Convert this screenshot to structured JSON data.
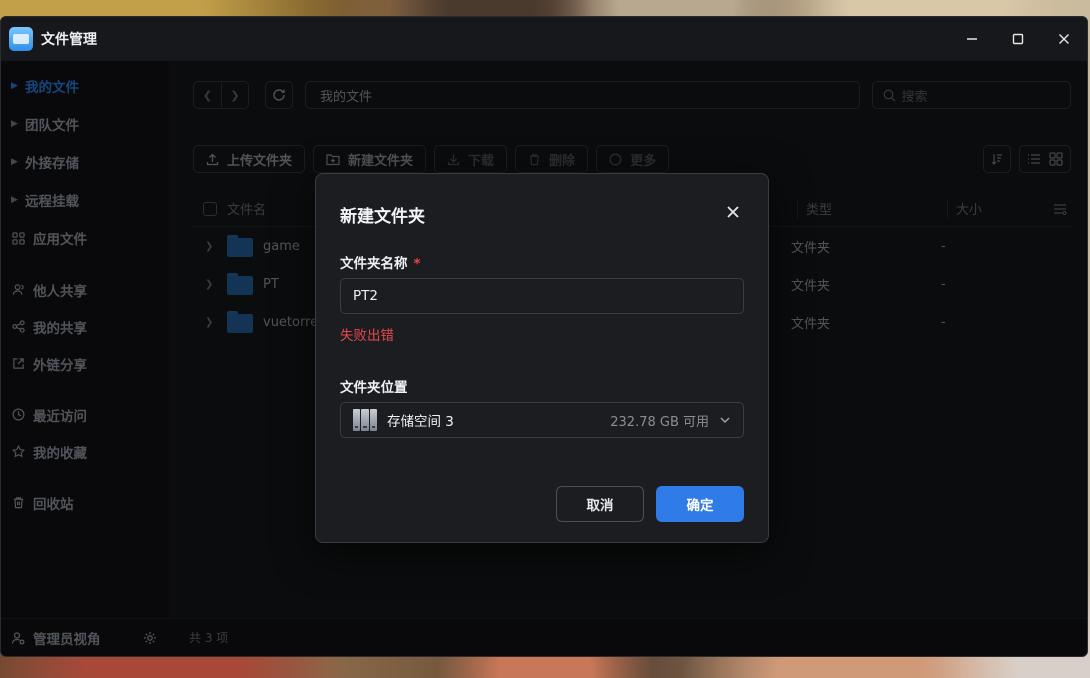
{
  "app": {
    "title": "文件管理",
    "icon": "file-manager-app-icon"
  },
  "window_controls": [
    "minimize-icon",
    "maximize-icon",
    "close-icon"
  ],
  "sidebar": {
    "items": [
      {
        "label": "我的文件",
        "icon": "chevron-right-icon",
        "active": true
      },
      {
        "label": "团队文件",
        "icon": "chevron-right-icon"
      },
      {
        "label": "外接存储",
        "icon": "chevron-right-icon"
      },
      {
        "label": "远程挂载",
        "icon": "chevron-right-icon"
      },
      {
        "label": "应用文件",
        "icon": "apps-grid-icon"
      },
      {
        "label": "他人共享",
        "icon": "users-icon"
      },
      {
        "label": "我的共享",
        "icon": "share-icon"
      },
      {
        "label": "外链分享",
        "icon": "external-link-icon"
      },
      {
        "label": "最近访问",
        "icon": "clock-icon"
      },
      {
        "label": "我的收藏",
        "icon": "star-icon"
      },
      {
        "label": "回收站",
        "icon": "trash-icon"
      }
    ],
    "admin_label": "管理员视角"
  },
  "main": {
    "path": "我的文件",
    "search_placeholder": "搜索",
    "toolbar": {
      "upload": "上传文件夹",
      "new_folder": "新建文件夹",
      "download": "下载",
      "delete": "删除",
      "more": "更多"
    },
    "table": {
      "headers": {
        "name": "文件名",
        "type": "类型",
        "size": "大小"
      },
      "rows": [
        {
          "name": "game",
          "type": "文件夹",
          "size": "-"
        },
        {
          "name": "PT",
          "type": "文件夹",
          "size": "-"
        },
        {
          "name": "vuetorre",
          "type": "文件夹",
          "size": "-"
        }
      ]
    },
    "count": "共 3 项"
  },
  "dialog": {
    "title": "新建文件夹",
    "name_label": "文件夹名称",
    "required_mark": "*",
    "name_value": "PT2",
    "error": "失败出错",
    "location_label": "文件夹位置",
    "location_name": "存储空间 3",
    "location_free": "232.78 GB 可用",
    "cancel": "取消",
    "confirm": "确定"
  },
  "colors": {
    "accent": "#2f7be8",
    "active_sidebar": "#1d5ea8",
    "error": "#e5484d",
    "window_bg": "#0f1012",
    "dialog_bg": "#1b1d21"
  }
}
